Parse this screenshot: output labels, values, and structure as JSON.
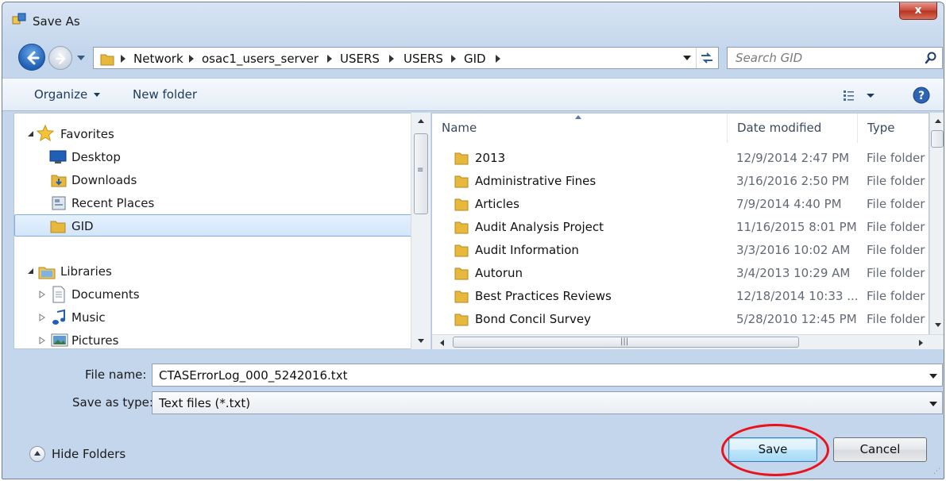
{
  "window": {
    "title": "Save As",
    "close_glyph": "x",
    "icon": "save-as-app-icon"
  },
  "nav": {
    "back_icon": "back-arrow-icon",
    "forward_icon": "forward-arrow-icon"
  },
  "address": {
    "crumbs": [
      "Network",
      "osac1_users_server",
      "USERS",
      "USERS",
      "GID"
    ]
  },
  "search": {
    "placeholder": "Search GID",
    "value": ""
  },
  "toolbar": {
    "organize": "Organize",
    "new_folder": "New folder",
    "views_icon": "view-options-icon",
    "help_icon": "help-icon"
  },
  "navpane": {
    "favorites": {
      "label": "Favorites",
      "items": [
        {
          "label": "Desktop",
          "icon": "desktop-icon"
        },
        {
          "label": "Downloads",
          "icon": "downloads-icon"
        },
        {
          "label": "Recent Places",
          "icon": "recent-places-icon"
        },
        {
          "label": "GID",
          "icon": "folder-icon",
          "selected": true
        }
      ]
    },
    "libraries": {
      "label": "Libraries",
      "items": [
        {
          "label": "Documents",
          "icon": "documents-icon"
        },
        {
          "label": "Music",
          "icon": "music-icon"
        },
        {
          "label": "Pictures",
          "icon": "pictures-icon"
        }
      ]
    }
  },
  "filelist": {
    "columns": {
      "name": "Name",
      "date": "Date modified",
      "type": "Type"
    },
    "rows": [
      {
        "name": "2013",
        "date": "12/9/2014 2:47 PM",
        "type": "File folder"
      },
      {
        "name": "Administrative Fines",
        "date": "3/16/2016 2:50 PM",
        "type": "File folder"
      },
      {
        "name": "Articles",
        "date": "7/9/2014 4:40 PM",
        "type": "File folder"
      },
      {
        "name": "Audit Analysis Project",
        "date": "11/16/2015 8:01 PM",
        "type": "File folder"
      },
      {
        "name": "Audit Information",
        "date": "3/3/2016 10:02 AM",
        "type": "File folder"
      },
      {
        "name": "Autorun",
        "date": "3/4/2013 10:29 AM",
        "type": "File folder"
      },
      {
        "name": "Best Practices Reviews",
        "date": "12/18/2014 10:33 ...",
        "type": "File folder"
      },
      {
        "name": "Bond Concil Survey",
        "date": "5/28/2010 12:45 PM",
        "type": "File folder"
      }
    ]
  },
  "form": {
    "file_name_label": "File name:",
    "file_name_value": "CTASErrorLog_000_5242016.txt",
    "save_type_label": "Save as type:",
    "save_type_value": "Text files (*.txt)"
  },
  "footer": {
    "hide_folders": "Hide Folders",
    "save": "Save",
    "cancel": "Cancel"
  },
  "colors": {
    "highlight_ring": "#e8131b",
    "close_button": "#c7483b",
    "selection": "#d3e6fb"
  }
}
